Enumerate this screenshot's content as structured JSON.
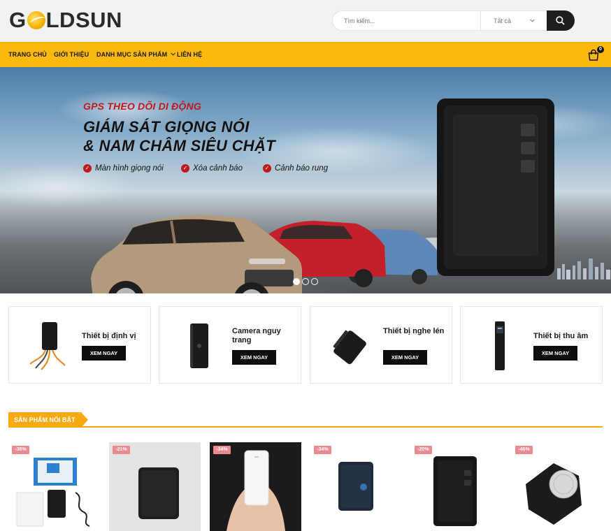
{
  "header": {
    "logo_text": [
      "G",
      "LDSUN"
    ],
    "search_placeholder": "Tìm kiếm...",
    "category_select": "Tất cả",
    "icons": {
      "search": "search-icon",
      "chevron": "chevron-down-icon",
      "cart": "cart-icon"
    }
  },
  "nav": {
    "items": [
      "TRANG CHỦ",
      "GIỚI THIỆU",
      "DANH MỤC SẢN PHẨM",
      "LIÊN HỆ"
    ],
    "dropdown_icon": "chevron-down-icon",
    "cart_count": "0"
  },
  "hero": {
    "subtitle": "GPS THEO DÕI DI ĐỘNG",
    "title_line1": "GIÁM SÁT GIỌNG NÓI",
    "title_line2": "& NAM CHÂM SIÊU CHẶT",
    "features": [
      "Màn hình giọng nói",
      "Xóa cảnh báo",
      "Cảnh báo rung"
    ],
    "slide_count": 3,
    "active_slide": 1
  },
  "categories": [
    {
      "title": "Thiết bị định vị",
      "button": "XEM NGAY"
    },
    {
      "title": "Camera nguy trang",
      "button": "XEM NGAY"
    },
    {
      "title": "Thiết bị nghe lén",
      "button": "XEM NGAY"
    },
    {
      "title": "Thiết bị thu âm",
      "button": "XEM NGAY"
    }
  ],
  "featured": {
    "heading": "SẢN PHẨM NỔI BẬT",
    "products": [
      {
        "discount": "-36%"
      },
      {
        "discount": "-21%"
      },
      {
        "discount": "-34%"
      },
      {
        "discount": "-34%"
      },
      {
        "discount": "-20%"
      },
      {
        "discount": "-46%"
      }
    ]
  },
  "colors": {
    "accent": "#fbb90f",
    "section_accent": "#f7a912",
    "hero_red": "#c0181c",
    "dark": "#0d0d0d",
    "discount": "#ec8b8f"
  }
}
